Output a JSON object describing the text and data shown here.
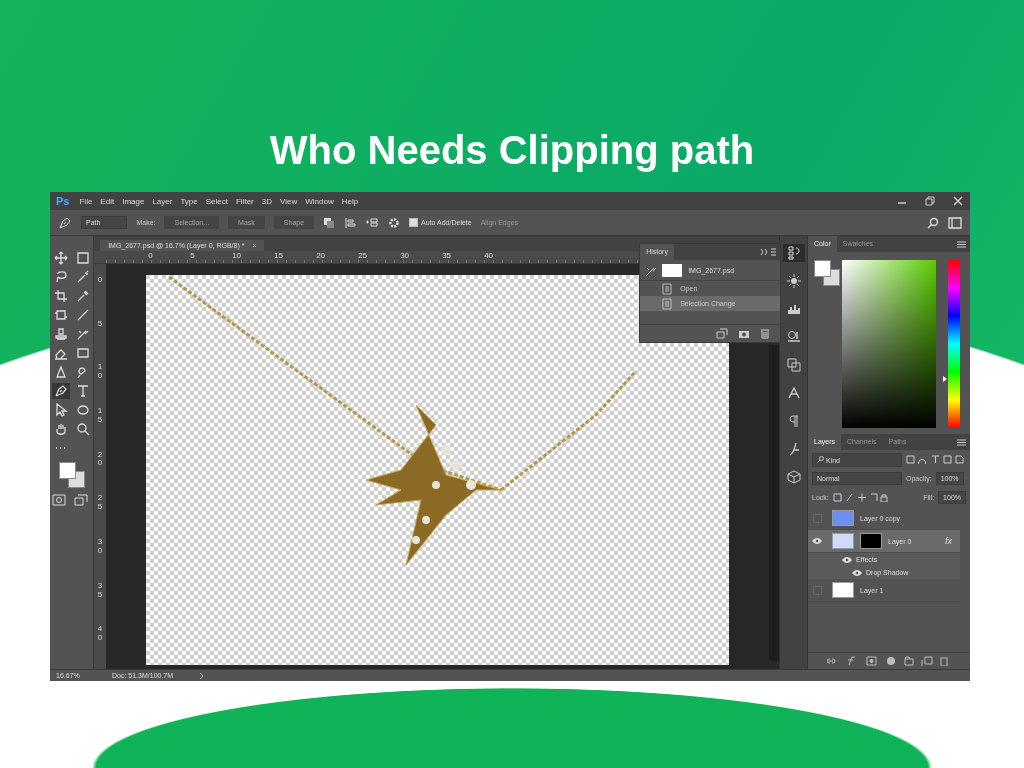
{
  "headline": "Who Needs Clipping path",
  "window": {
    "logo": "Ps",
    "menu": [
      "File",
      "Edit",
      "Image",
      "Layer",
      "Type",
      "Select",
      "Filter",
      "3D",
      "View",
      "Window",
      "Help"
    ]
  },
  "options_bar": {
    "mode": "Path",
    "make_label": "Make:",
    "make_buttons": [
      {
        "label": "Selection...",
        "disabled": true
      },
      {
        "label": "Mask",
        "disabled": true
      },
      {
        "label": "Shape",
        "disabled": true
      }
    ],
    "auto_add_delete": {
      "label": "Auto Add/Delete",
      "checked": true
    },
    "align_edges": {
      "label": "Align Edges",
      "disabled": true
    }
  },
  "toolbox": {
    "tools": [
      {
        "kind": "move",
        "selected": false
      },
      {
        "kind": "marquee",
        "selected": false
      },
      {
        "kind": "lasso",
        "selected": false
      },
      {
        "kind": "wand",
        "selected": false
      },
      {
        "kind": "crop",
        "selected": false
      },
      {
        "kind": "eyedropper",
        "selected": false
      },
      {
        "kind": "patch",
        "selected": false
      },
      {
        "kind": "brush",
        "selected": false
      },
      {
        "kind": "stamp",
        "selected": false
      },
      {
        "kind": "history-brush",
        "selected": false
      },
      {
        "kind": "eraser",
        "selected": false
      },
      {
        "kind": "gradient",
        "selected": false
      },
      {
        "kind": "blur",
        "selected": false
      },
      {
        "kind": "dodge",
        "selected": false
      },
      {
        "kind": "pen",
        "selected": true
      },
      {
        "kind": "type",
        "selected": false
      },
      {
        "kind": "select",
        "selected": false
      },
      {
        "kind": "ellipse",
        "selected": false
      },
      {
        "kind": "hand",
        "selected": false
      },
      {
        "kind": "zoom",
        "selected": false
      },
      {
        "kind": "more",
        "selected": false
      }
    ]
  },
  "document": {
    "tab": "IMG_2677.psd @ 16.7% (Layer 0, RGB/8) *",
    "close": "×",
    "top_ruler": [
      "0",
      "5",
      "10",
      "15",
      "20",
      "25",
      "30",
      "35",
      "40"
    ],
    "left_ruler": [
      "0",
      "5",
      "10",
      "15",
      "20",
      "25",
      "30",
      "35",
      "40"
    ]
  },
  "history": {
    "title": "History",
    "snapshot": "IMG_2677.psd",
    "steps": [
      {
        "label": "Open",
        "selected": false
      },
      {
        "label": "Selection Change",
        "selected": true
      }
    ]
  },
  "color_panel": {
    "tabs": [
      {
        "label": "Color",
        "selected": true
      },
      {
        "label": "Swatches",
        "selected": false
      }
    ],
    "hue": {
      "level": 0.29
    }
  },
  "layers_panel": {
    "tabs": [
      {
        "label": "Layers",
        "selected": true
      },
      {
        "label": "Channels",
        "selected": false
      },
      {
        "label": "Paths",
        "selected": false
      }
    ],
    "filter": "Kind",
    "blend_mode": "Normal",
    "opacity_label": "Opacity:",
    "opacity": "100%",
    "lock_label": "Lock:",
    "fill_label": "Fill:",
    "fill": "100%",
    "layers": [
      {
        "name": "Layer 0 copy",
        "visible": false,
        "selected": false,
        "color": "#6f8ff0",
        "mask": false
      },
      {
        "name": "Layer 0",
        "visible": true,
        "selected": true,
        "color": "#cfdcff",
        "mask": true,
        "fx": "fx",
        "children": [
          {
            "name": "Effects",
            "visible": true,
            "children": [
              {
                "name": "Drop Shadow",
                "visible": true
              }
            ]
          }
        ]
      },
      {
        "name": "Layer 1",
        "visible": false,
        "selected": false,
        "color": "#ffffff",
        "mask": false
      }
    ]
  },
  "status_bar": {
    "zoom": "16.67%",
    "doc": "Doc: 51.3M/100.7M"
  }
}
